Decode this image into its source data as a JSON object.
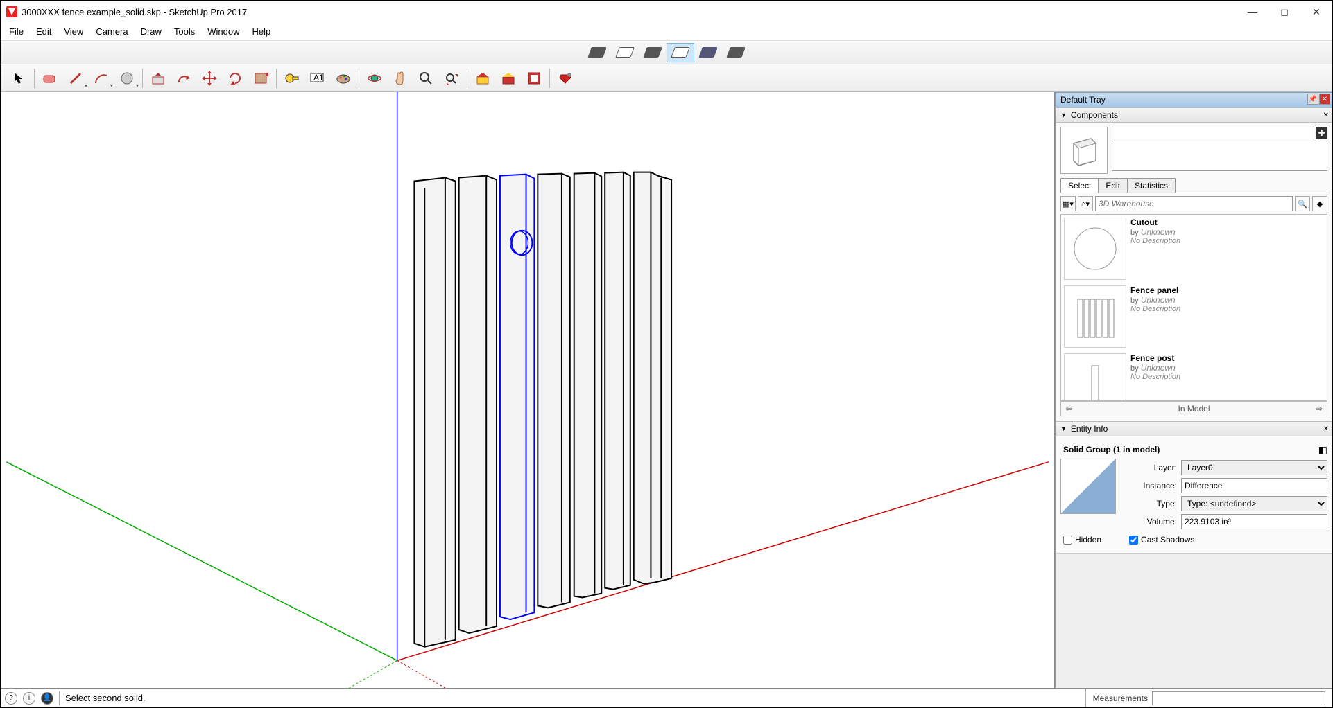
{
  "window": {
    "title": "3000XXX fence example_solid.skp - SketchUp Pro 2017"
  },
  "menu": [
    "File",
    "Edit",
    "View",
    "Camera",
    "Draw",
    "Tools",
    "Window",
    "Help"
  ],
  "tooltips": {
    "shadow_modes": [
      "Shadow mode 1",
      "Shadow mode 2",
      "Shadow mode 3",
      "Shadow mode 4 (active)",
      "Shadow mode 5",
      "Shadow mode 6"
    ]
  },
  "tray": {
    "title": "Default Tray",
    "components": {
      "title": "Components",
      "sub_tabs": [
        "Select",
        "Edit",
        "Statistics"
      ],
      "search_placeholder": "3D Warehouse",
      "items": [
        {
          "name": "Cutout",
          "by": "Unknown",
          "desc": "No Description"
        },
        {
          "name": "Fence panel",
          "by": "Unknown",
          "desc": "No Description"
        },
        {
          "name": "Fence post",
          "by": "Unknown",
          "desc": "No Description"
        }
      ],
      "nav_label": "In Model"
    },
    "entity_info": {
      "title": "Entity Info",
      "heading": "Solid Group (1 in model)",
      "layer_label": "Layer:",
      "layer_value": "Layer0",
      "instance_label": "Instance:",
      "instance_value": "Difference",
      "type_label": "Type:",
      "type_value": "Type: <undefined>",
      "volume_label": "Volume:",
      "volume_value": "223.9103 in³",
      "hidden_label": "Hidden",
      "cast_shadows_label": "Cast Shadows"
    }
  },
  "status": {
    "message": "Select second solid.",
    "measurements_label": "Measurements"
  }
}
